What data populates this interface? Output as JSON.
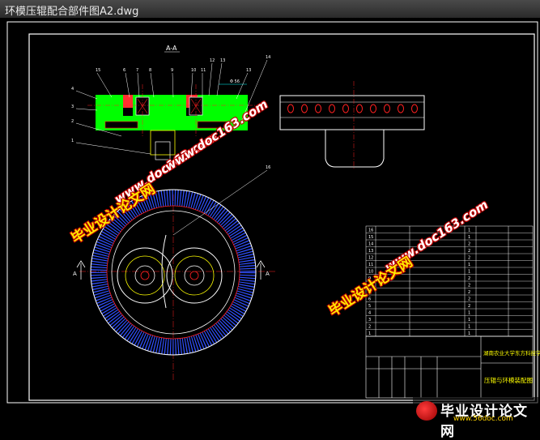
{
  "window": {
    "title": "环模压辊配合部件图A2.dwg"
  },
  "drawing": {
    "section_label": "A-A",
    "marker_a": "A",
    "balloons": [
      "1",
      "2",
      "3",
      "4",
      "5",
      "6",
      "7",
      "8",
      "9",
      "10",
      "11",
      "12",
      "13",
      "14",
      "15",
      "16"
    ],
    "dimension": "Φ 56"
  },
  "watermarks": {
    "cn": "毕业设计论文网",
    "url": "www.doc163.com"
  },
  "title_block": {
    "school": "湖南农业大学东方科技学院",
    "drawing_name": "压辊与环模装配图",
    "bom_rows": [
      {
        "no": "16",
        "name": "",
        "qty": "1",
        "mat": "",
        "remark": ""
      },
      {
        "no": "15",
        "name": "",
        "qty": "1",
        "mat": "",
        "remark": ""
      },
      {
        "no": "14",
        "name": "",
        "qty": "2",
        "mat": "",
        "remark": ""
      },
      {
        "no": "13",
        "name": "",
        "qty": "2",
        "mat": "",
        "remark": ""
      },
      {
        "no": "12",
        "name": "",
        "qty": "2",
        "mat": "",
        "remark": ""
      },
      {
        "no": "11",
        "name": "",
        "qty": "1",
        "mat": "",
        "remark": ""
      },
      {
        "no": "10",
        "name": "",
        "qty": "1",
        "mat": "",
        "remark": ""
      },
      {
        "no": "9",
        "name": "",
        "qty": "2",
        "mat": "",
        "remark": ""
      },
      {
        "no": "8",
        "name": "",
        "qty": "2",
        "mat": "",
        "remark": ""
      },
      {
        "no": "7",
        "name": "",
        "qty": "2",
        "mat": "",
        "remark": ""
      },
      {
        "no": "6",
        "name": "",
        "qty": "2",
        "mat": "",
        "remark": ""
      },
      {
        "no": "5",
        "name": "",
        "qty": "2",
        "mat": "",
        "remark": ""
      },
      {
        "no": "4",
        "name": "",
        "qty": "1",
        "mat": "",
        "remark": ""
      },
      {
        "no": "3",
        "name": "",
        "qty": "1",
        "mat": "",
        "remark": ""
      },
      {
        "no": "2",
        "name": "",
        "qty": "1",
        "mat": "",
        "remark": ""
      },
      {
        "no": "1",
        "name": "",
        "qty": "1",
        "mat": "",
        "remark": ""
      }
    ]
  },
  "footer": {
    "brand": "毕业设计论文网",
    "url": "www.56doc.com"
  },
  "colors": {
    "background": "#000000",
    "green_fill": "#00ff00",
    "red_lines": "#ff2020",
    "blue_teeth": "#3050ff",
    "yellow_lines": "#ffff00",
    "white_lines": "#ffffff",
    "cyan_lines": "#00ffff"
  }
}
